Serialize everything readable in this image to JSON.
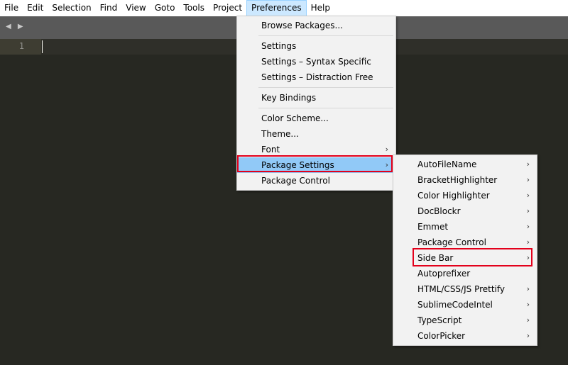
{
  "menubar": {
    "items": [
      "File",
      "Edit",
      "Selection",
      "Find",
      "View",
      "Goto",
      "Tools",
      "Project",
      "Preferences",
      "Help"
    ]
  },
  "tabbar": {
    "nav_arrows": "◀ ▶"
  },
  "editor": {
    "line_number": "1"
  },
  "preferences_menu": {
    "browse_packages": "Browse Packages...",
    "settings": "Settings",
    "settings_syntax": "Settings – Syntax Specific",
    "settings_distraction": "Settings – Distraction Free",
    "key_bindings": "Key Bindings",
    "color_scheme": "Color Scheme...",
    "theme": "Theme...",
    "font": "Font",
    "package_settings": "Package Settings",
    "package_control": "Package Control"
  },
  "package_settings_menu": {
    "items": [
      "AutoFileName",
      "BracketHighlighter",
      "Color Highlighter",
      "DocBlockr",
      "Emmet",
      "Package Control",
      "Side Bar",
      "Autoprefixer",
      "HTML/CSS/JS Prettify",
      "SublimeCodeIntel",
      "TypeScript",
      "ColorPicker"
    ]
  },
  "submenu_arrow": "›",
  "colors": {
    "highlight": "#91c9f7",
    "annotation": "#e3001b",
    "editor_bg": "#272822"
  }
}
